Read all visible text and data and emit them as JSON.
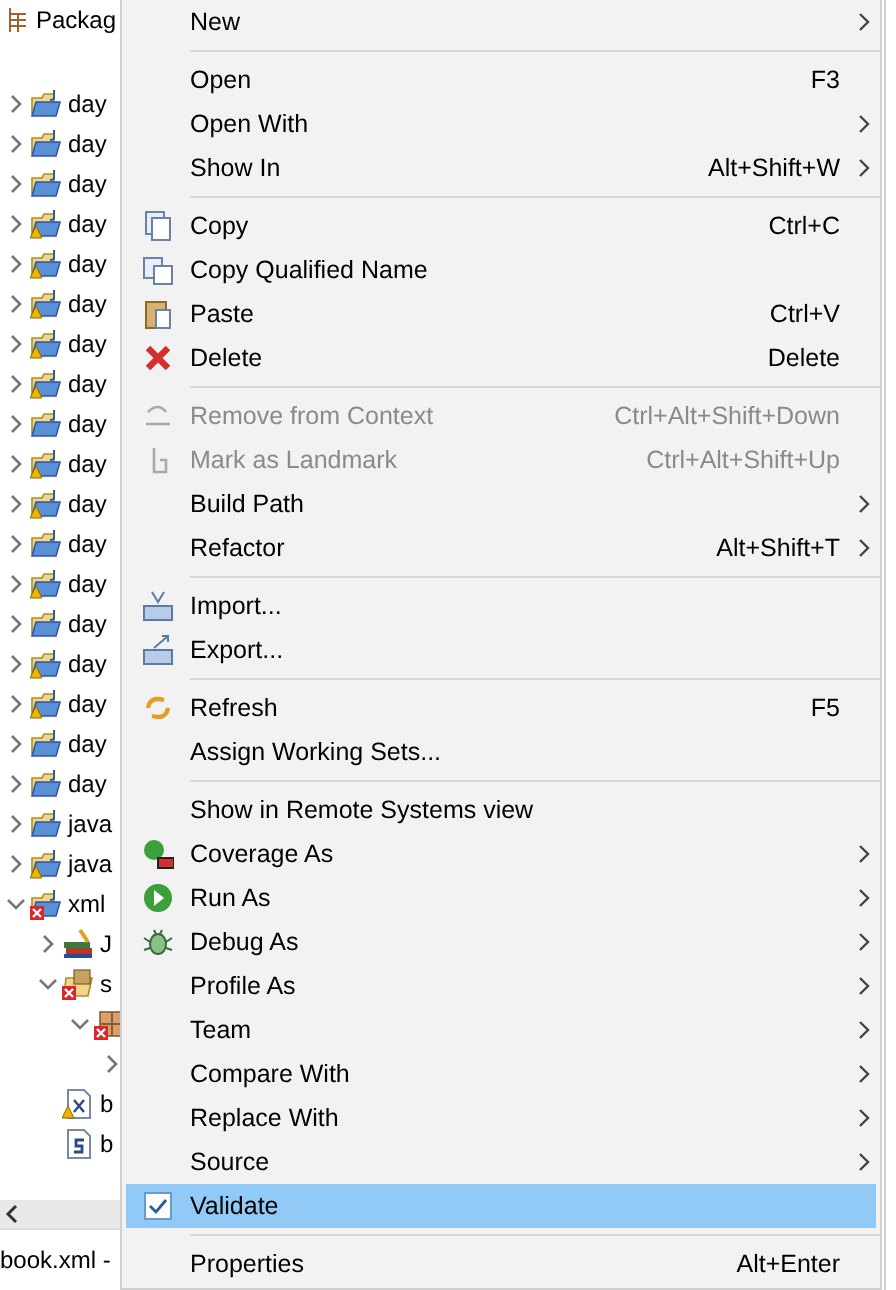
{
  "explorer": {
    "title": "Packag",
    "tree": [
      {
        "label": "day",
        "warning": false,
        "expanded": false
      },
      {
        "label": "day",
        "warning": false,
        "expanded": false
      },
      {
        "label": "day",
        "warning": false,
        "expanded": false
      },
      {
        "label": "day",
        "warning": true,
        "expanded": false
      },
      {
        "label": "day",
        "warning": true,
        "expanded": false
      },
      {
        "label": "day",
        "warning": true,
        "expanded": false
      },
      {
        "label": "day",
        "warning": true,
        "expanded": false
      },
      {
        "label": "day",
        "warning": true,
        "expanded": false
      },
      {
        "label": "day",
        "warning": false,
        "expanded": false
      },
      {
        "label": "day",
        "warning": true,
        "expanded": false
      },
      {
        "label": "day",
        "warning": true,
        "expanded": false
      },
      {
        "label": "day",
        "warning": false,
        "expanded": false
      },
      {
        "label": "day",
        "warning": true,
        "expanded": false
      },
      {
        "label": "day",
        "warning": false,
        "expanded": false
      },
      {
        "label": "day",
        "warning": true,
        "expanded": false
      },
      {
        "label": "day",
        "warning": true,
        "expanded": false
      },
      {
        "label": "day",
        "warning": false,
        "expanded": false
      },
      {
        "label": "day",
        "warning": false,
        "expanded": false
      },
      {
        "label": "java",
        "warning": false,
        "expanded": false
      },
      {
        "label": "java",
        "warning": true,
        "expanded": false
      },
      {
        "label": "xml",
        "error": true,
        "expanded": true,
        "children": [
          {
            "label": "J",
            "kind": "library",
            "expanded": false
          },
          {
            "label": "s",
            "kind": "source",
            "error": true,
            "expanded": true,
            "children": [
              {
                "kind": "package",
                "error": true,
                "expanded": true,
                "children": [
                  {
                    "expanded": false
                  }
                ]
              }
            ]
          },
          {
            "label": "b",
            "kind": "xml",
            "warning": true
          },
          {
            "label": "b",
            "kind": "schema",
            "warning": false
          }
        ]
      }
    ],
    "status": "book.xml -"
  },
  "menu": [
    {
      "kind": "item",
      "label": "New",
      "submenu": true
    },
    {
      "kind": "separator"
    },
    {
      "kind": "item",
      "label": "Open",
      "shortcut": "F3"
    },
    {
      "kind": "item",
      "label": "Open With",
      "submenu": true
    },
    {
      "kind": "item",
      "label": "Show In",
      "shortcut": "Alt+Shift+W",
      "submenu": true
    },
    {
      "kind": "separator"
    },
    {
      "kind": "copy",
      "label": "Copy",
      "shortcut": "Ctrl+C"
    },
    {
      "kind": "copyname",
      "label": "Copy Qualified Name"
    },
    {
      "kind": "paste",
      "label": "Paste",
      "shortcut": "Ctrl+V"
    },
    {
      "kind": "delete",
      "label": "Delete",
      "shortcut": "Delete"
    },
    {
      "kind": "separator"
    },
    {
      "kind": "remove",
      "label": "Remove from Context",
      "shortcut": "Ctrl+Alt+Shift+Down",
      "disabled": true
    },
    {
      "kind": "landmark",
      "label": "Mark as Landmark",
      "shortcut": "Ctrl+Alt+Shift+Up",
      "disabled": true
    },
    {
      "kind": "item",
      "label": "Build Path",
      "submenu": true
    },
    {
      "kind": "item",
      "label": "Refactor",
      "shortcut": "Alt+Shift+T",
      "submenu": true
    },
    {
      "kind": "separator"
    },
    {
      "kind": "import",
      "label": "Import..."
    },
    {
      "kind": "export",
      "label": "Export..."
    },
    {
      "kind": "separator"
    },
    {
      "kind": "refresh",
      "label": "Refresh",
      "shortcut": "F5"
    },
    {
      "kind": "item",
      "label": "Assign Working Sets..."
    },
    {
      "kind": "separator"
    },
    {
      "kind": "item",
      "label": "Show in Remote Systems view"
    },
    {
      "kind": "coverage",
      "label": "Coverage As",
      "submenu": true
    },
    {
      "kind": "run",
      "label": "Run As",
      "submenu": true
    },
    {
      "kind": "debug",
      "label": "Debug As",
      "submenu": true
    },
    {
      "kind": "item",
      "label": "Profile As",
      "submenu": true
    },
    {
      "kind": "item",
      "label": "Team",
      "submenu": true
    },
    {
      "kind": "item",
      "label": "Compare With",
      "submenu": true
    },
    {
      "kind": "item",
      "label": "Replace With",
      "submenu": true
    },
    {
      "kind": "item",
      "label": "Source",
      "submenu": true
    },
    {
      "kind": "item",
      "label": "Validate",
      "checked": true,
      "selected": true
    },
    {
      "kind": "separator"
    },
    {
      "kind": "item",
      "label": "Properties",
      "shortcut": "Alt+Enter"
    }
  ]
}
